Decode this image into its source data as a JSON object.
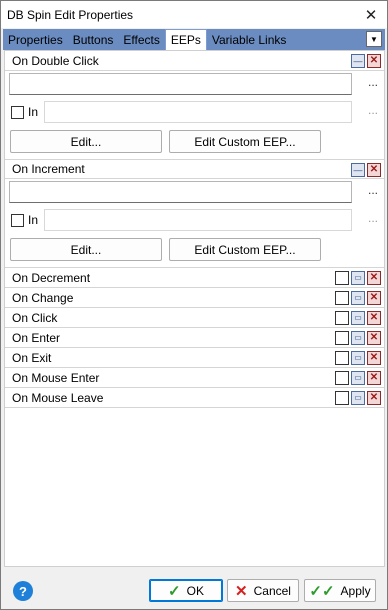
{
  "window": {
    "title": "DB Spin Edit Properties"
  },
  "tabs": [
    {
      "label": "Properties"
    },
    {
      "label": "Buttons"
    },
    {
      "label": "Effects"
    },
    {
      "label": "EEPs"
    },
    {
      "label": "Variable Links"
    }
  ],
  "active_tab": "EEPs",
  "sections": [
    {
      "label": "On Double Click",
      "expression_value": "",
      "in_label": "In",
      "in_value": "",
      "in_checked": false,
      "edit_label": "Edit...",
      "edit_custom_label": "Edit Custom EEP...",
      "ellipsis": "..."
    },
    {
      "label": "On Increment",
      "expression_value": "",
      "in_label": "In",
      "in_value": "",
      "in_checked": false,
      "edit_label": "Edit...",
      "edit_custom_label": "Edit Custom EEP...",
      "ellipsis": "..."
    }
  ],
  "events": [
    {
      "label": "On Decrement"
    },
    {
      "label": "On Change"
    },
    {
      "label": "On Click"
    },
    {
      "label": "On Enter"
    },
    {
      "label": "On Exit"
    },
    {
      "label": "On Mouse Enter"
    },
    {
      "label": "On Mouse Leave"
    }
  ],
  "footer": {
    "help": "?",
    "ok_label": "OK",
    "cancel_label": "Cancel",
    "apply_label": "Apply"
  },
  "icons": {
    "close": "close-icon",
    "help": "help-icon",
    "ok": "checkmark-icon",
    "cancel": "x-icon",
    "apply": "double-checkmark-icon"
  },
  "colors": {
    "tabbar": "#6a8cc1",
    "ok_border": "#0078d7",
    "help": "#1e80d8"
  }
}
